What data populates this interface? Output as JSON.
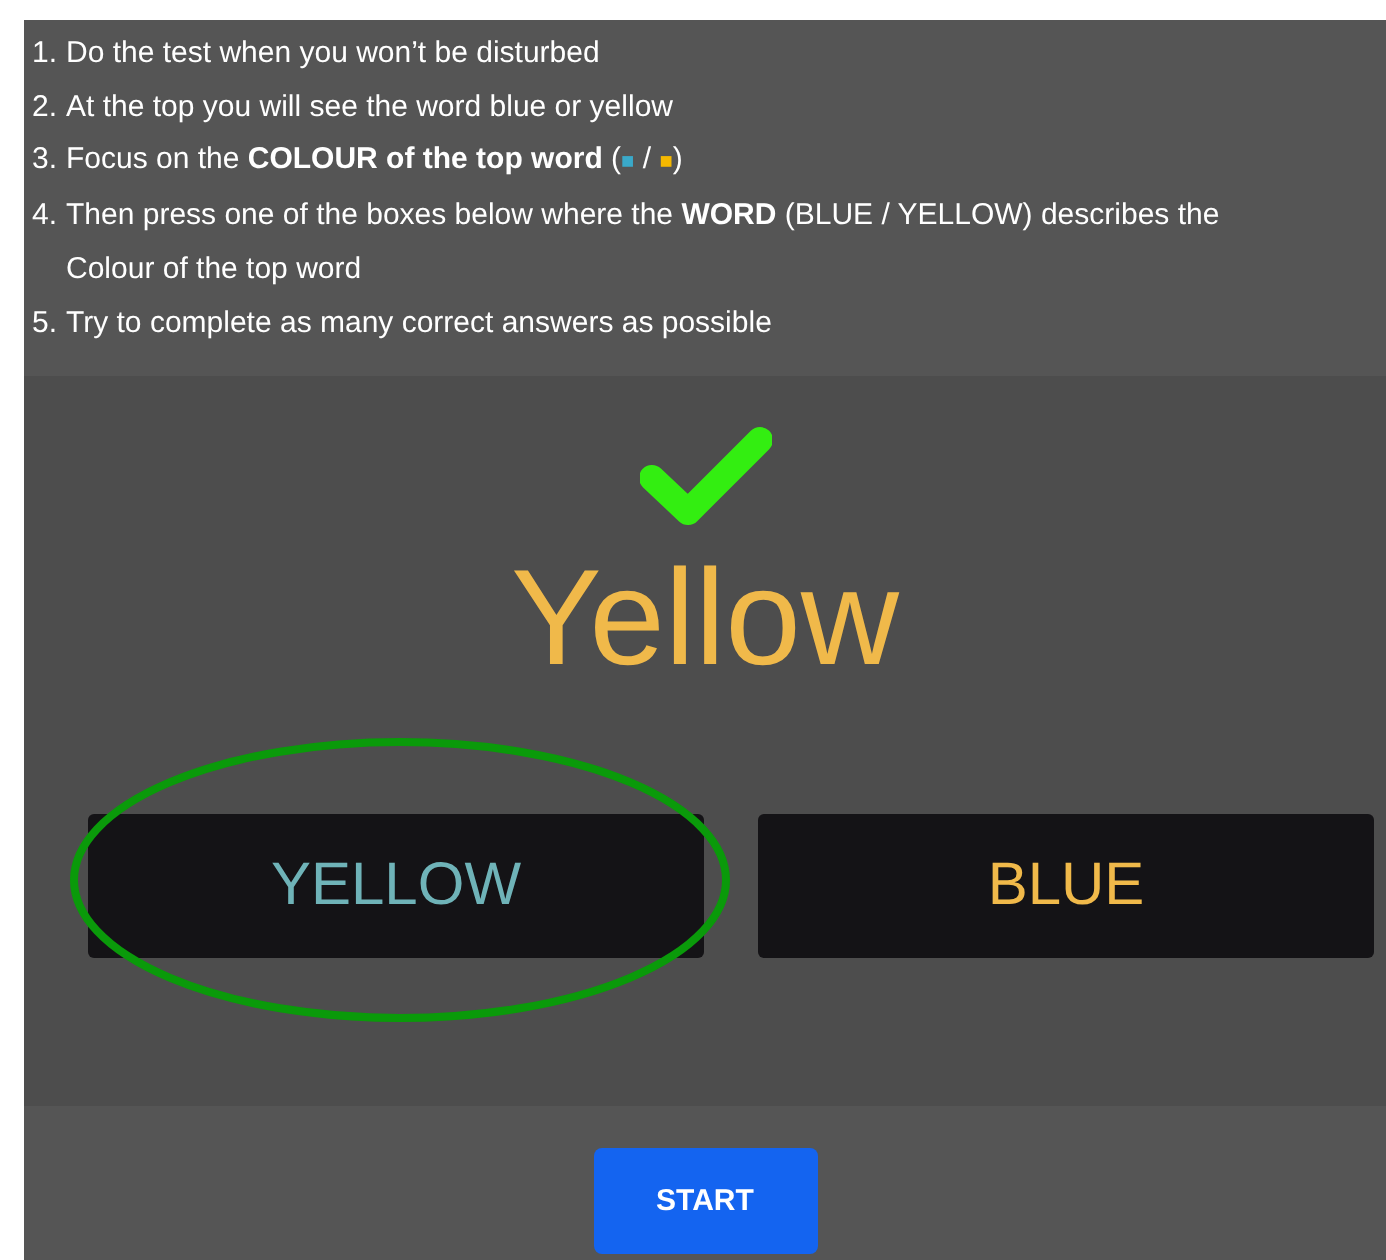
{
  "instructions": [
    {
      "number": "1.",
      "text": "Do the test when you won’t be disturbed"
    },
    {
      "number": "2.",
      "text": "At the top you will see the word blue or yellow"
    },
    {
      "number": "3.",
      "text": "Focus on the **COLOUR of the top word** (",
      "swatches": [
        {
          "glyph": "■",
          "color": "#3aa9c9"
        },
        {
          "glyph": "■",
          "color": "#f5b800"
        }
      ],
      "separator": "/",
      "closing": ")"
    },
    {
      "number": "4.",
      "text": "Then press one of the boxes below where the **WORD** (BLUE / YELLOW) describes the Colour of the top word"
    },
    {
      "number": "5.",
      "text": "Try to complete as many correct answers as possible"
    }
  ],
  "feedback": {
    "correct": true
  },
  "word": {
    "text": "Yellow",
    "color": "#f0b94a"
  },
  "options": [
    {
      "label": "YELLOW",
      "color": "#6fb3b8",
      "circled": true
    },
    {
      "label": "BLUE",
      "color": "#f0b94a",
      "circled": false
    }
  ],
  "start_button": "START"
}
